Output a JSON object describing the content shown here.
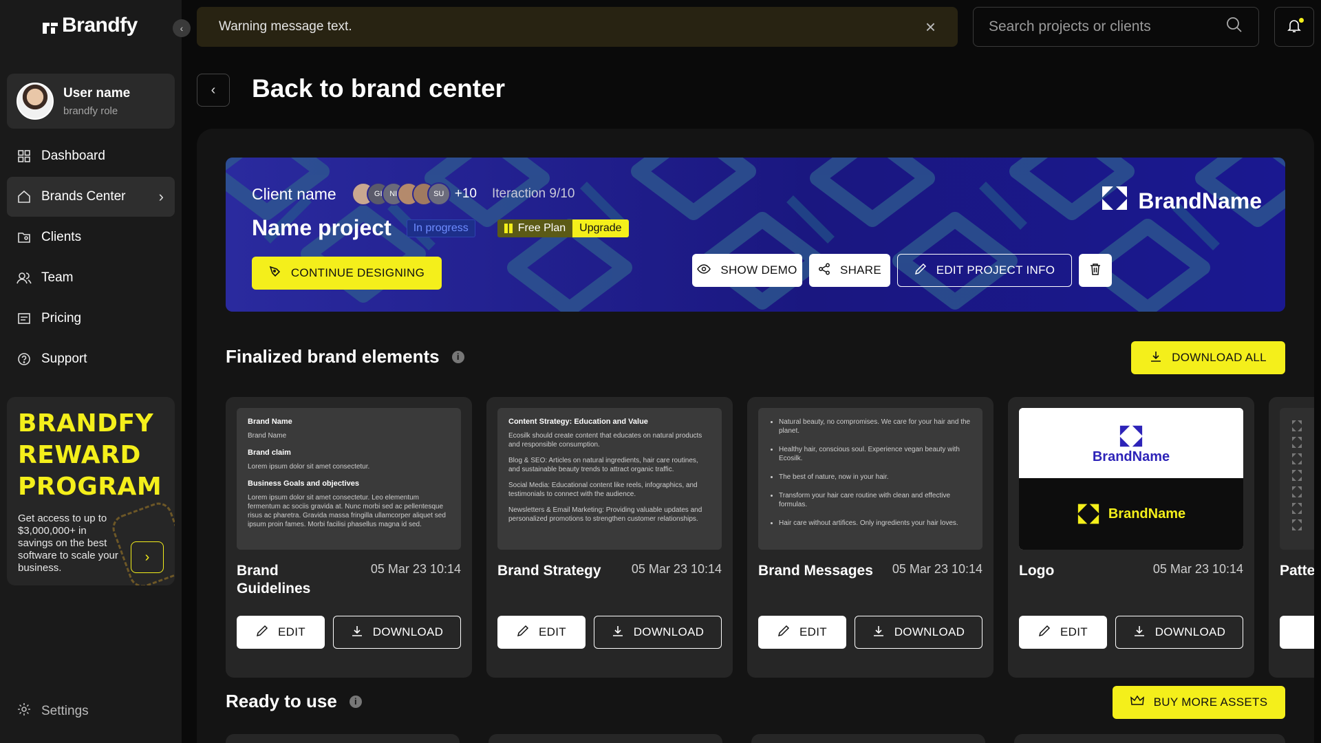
{
  "app": {
    "name": "Brandfy"
  },
  "user": {
    "name": "User name",
    "role": "brandfy role"
  },
  "nav": [
    {
      "label": "Dashboard",
      "icon": "grid-icon"
    },
    {
      "label": "Brands Center",
      "icon": "home-icon",
      "active": true
    },
    {
      "label": "Clients",
      "icon": "clients-icon"
    },
    {
      "label": "Team",
      "icon": "team-icon"
    },
    {
      "label": "Pricing",
      "icon": "pricing-icon"
    },
    {
      "label": "Support",
      "icon": "help-icon"
    }
  ],
  "reward": {
    "title_line1": "BRANDFY",
    "title_line2": "REWARD",
    "title_line3": "PROGRAM",
    "text": "Get access to up to $3,000,000+ in savings on the best software to scale your business."
  },
  "settings_label": "Settings",
  "warning": {
    "text": "Warning message text."
  },
  "search": {
    "placeholder": "Search projects or clients"
  },
  "page": {
    "title": "Back to brand center"
  },
  "banner": {
    "client_label": "Client name",
    "avatars": [
      "",
      "GI",
      "NI",
      "",
      "",
      "SU"
    ],
    "more_count": "+10",
    "iteration": "Iteraction 9/10",
    "project_name": "Name project",
    "status": "In progress",
    "plan": "Free Plan",
    "upgrade": "Upgrade",
    "continue_label": "CONTINUE DESIGNING",
    "brand_name": "BrandName",
    "show_demo_label": "SHOW DEMO",
    "share_label": "SHARE",
    "edit_info_label": "EDIT PROJECT INFO"
  },
  "finalized": {
    "title": "Finalized brand elements",
    "download_all_label": "DOWNLOAD ALL",
    "edit_label": "EDIT",
    "download_label": "DOWNLOAD",
    "cards": [
      {
        "name": "Brand Guidelines",
        "date": "05 Mar 23 10:14",
        "preview": {
          "h1": "Brand Name",
          "s1": "Brand Name",
          "h2": "Brand claim",
          "s2": "Lorem ipsum dolor sit amet consectetur.",
          "h3": "Business Goals and objectives",
          "s3": "Lorem ipsum dolor sit amet consectetur. Leo elementum fermentum ac sociis gravida at. Nunc morbi sed ac pellentesque risus ac pharetra. Gravida massa fringilla ullamcorper aliquet sed ipsum proin fames. Morbi facilisi phasellus magna id sed."
        }
      },
      {
        "name": "Brand Strategy",
        "date": "05 Mar 23 10:14",
        "preview": {
          "h1": "Content Strategy: Education and Value",
          "p1": "Ecosilk should create content that educates on natural products and responsible consumption.",
          "p2": "Blog & SEO: Articles on natural ingredients, hair care routines, and sustainable beauty trends to attract organic traffic.",
          "p3": "Social Media:  Educational content like reels, infographics, and testimonials to connect with the audience.",
          "p4": "Newsletters & Email Marketing:  Providing valuable updates and personalized promotions to strengthen customer relationships."
        }
      },
      {
        "name": "Brand Messages",
        "date": "05 Mar 23 10:14",
        "preview": {
          "b1": "Natural beauty, no compromises. We care for your hair and the planet.",
          "b2": "Healthy hair, conscious soul. Experience vegan beauty with Ecosilk.",
          "b3": "The best of nature, now in your hair.",
          "b4": "Transform your hair care routine with clean and effective formulas.",
          "b5": "Hair care without artifices. Only ingredients your hair loves."
        }
      },
      {
        "name": "Logo",
        "date": "05 Mar 23 10:14",
        "preview": {
          "brand_name": "BrandName"
        }
      },
      {
        "name": "Patte",
        "date": ""
      }
    ]
  },
  "ready": {
    "title": "Ready to use",
    "buy_label": "BUY MORE ASSETS"
  },
  "colors": {
    "accent": "#f4ef1b",
    "banner": "#15127a",
    "sidebar": "#1a1a1a",
    "card": "#262626"
  }
}
